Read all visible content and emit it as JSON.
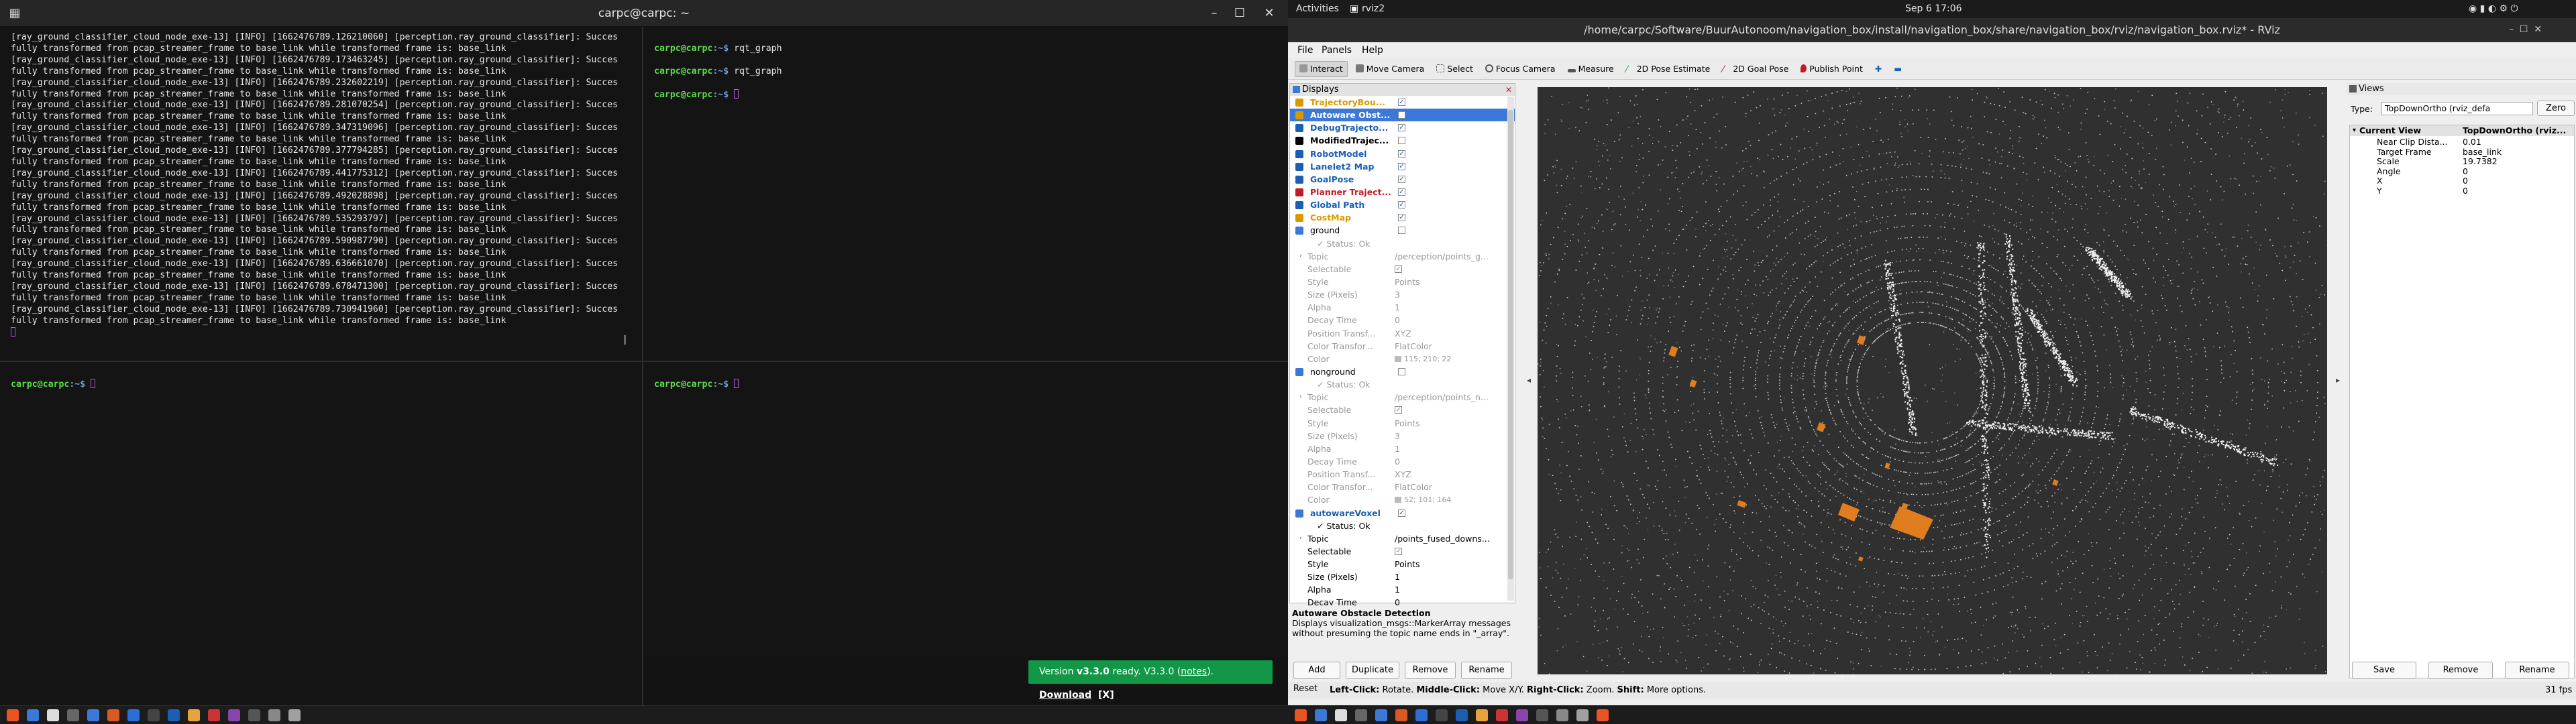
{
  "terminal": {
    "title": "carpc@carpc: ~",
    "log_lines": [
      "[ray_ground_classifier_cloud_node_exe-13] [INFO] [1662476789.126210060] [perception.ray_ground_classifier]: Succes",
      "fully transformed from pcap_streamer_frame to base_link while transformed frame is: base_link",
      "[ray_ground_classifier_cloud_node_exe-13] [INFO] [1662476789.173463245] [perception.ray_ground_classifier]: Succes",
      "fully transformed from pcap_streamer_frame to base_link while transformed frame is: base_link",
      "[ray_ground_classifier_cloud_node_exe-13] [INFO] [1662476789.232602219] [perception.ray_ground_classifier]: Succes",
      "fully transformed from pcap_streamer_frame to base_link while transformed frame is: base_link",
      "[ray_ground_classifier_cloud_node_exe-13] [INFO] [1662476789.281070254] [perception.ray_ground_classifier]: Succes",
      "fully transformed from pcap_streamer_frame to base_link while transformed frame is: base_link",
      "[ray_ground_classifier_cloud_node_exe-13] [INFO] [1662476789.347319096] [perception.ray_ground_classifier]: Succes",
      "fully transformed from pcap_streamer_frame to base_link while transformed frame is: base_link",
      "[ray_ground_classifier_cloud_node_exe-13] [INFO] [1662476789.377794285] [perception.ray_ground_classifier]: Succes",
      "fully transformed from pcap_streamer_frame to base_link while transformed frame is: base_link",
      "[ray_ground_classifier_cloud_node_exe-13] [INFO] [1662476789.441775312] [perception.ray_ground_classifier]: Succes",
      "fully transformed from pcap_streamer_frame to base_link while transformed frame is: base_link",
      "[ray_ground_classifier_cloud_node_exe-13] [INFO] [1662476789.492028898] [perception.ray_ground_classifier]: Succes",
      "fully transformed from pcap_streamer_frame to base_link while transformed frame is: base_link",
      "[ray_ground_classifier_cloud_node_exe-13] [INFO] [1662476789.535293797] [perception.ray_ground_classifier]: Succes",
      "fully transformed from pcap_streamer_frame to base_link while transformed frame is: base_link",
      "[ray_ground_classifier_cloud_node_exe-13] [INFO] [1662476789.590987790] [perception.ray_ground_classifier]: Succes",
      "fully transformed from pcap_streamer_frame to base_link while transformed frame is: base_link",
      "[ray_ground_classifier_cloud_node_exe-13] [INFO] [1662476789.636661070] [perception.ray_ground_classifier]: Succes",
      "fully transformed from pcap_streamer_frame to base_link while transformed frame is: base_link",
      "[ray_ground_classifier_cloud_node_exe-13] [INFO] [1662476789.678471300] [perception.ray_ground_classifier]: Succes",
      "fully transformed from pcap_streamer_frame to base_link while transformed frame is: base_link",
      "[ray_ground_classifier_cloud_node_exe-13] [INFO] [1662476789.730941960] [perception.ray_ground_classifier]: Succes",
      "fully transformed from pcap_streamer_frame to base_link while transformed frame is: base_link"
    ],
    "prompt_user": "carpc@carpc",
    "prompt_path": ":~$ ",
    "commands": [
      "rqt_graph",
      "rqt_graph"
    ],
    "notification": {
      "prefix": "Version ",
      "version": "v3.3.0",
      "middle": " ready. V3.3.0 (",
      "notes": "notes",
      "after": "). ",
      "download": "Download",
      "close": "[X]"
    }
  },
  "gnome": {
    "activities": "Activities",
    "app": "rviz2",
    "clock": "Sep 6  17:06"
  },
  "rviz": {
    "title": "/home/carpc/Software/BuurAutonoom/navigation_box/install/navigation_box/share/navigation_box/rviz/navigation_box.rviz* - RViz",
    "menu": [
      "File",
      "Panels",
      "Help"
    ],
    "tools": [
      "Interact",
      "Move Camera",
      "Select",
      "Focus Camera",
      "Measure",
      "2D Pose Estimate",
      "2D Goal Pose",
      "Publish Point"
    ],
    "displays_title": "Displays",
    "displays": [
      {
        "name": "TrajectoryBou...",
        "color": "#d99a00",
        "checked": true
      },
      {
        "name": "Autoware Obst...",
        "color": "#d99a00",
        "checked": false,
        "selected": true
      },
      {
        "name": "DebugTrajecto...",
        "color": "#1a5fb4",
        "checked": true
      },
      {
        "name": "ModifiedTrajec...",
        "color": "#000000",
        "checked": false
      },
      {
        "name": "RobotModel",
        "color": "#1a5fb4",
        "checked": true
      },
      {
        "name": "Lanelet2 Map",
        "color": "#1a5fb4",
        "checked": true
      },
      {
        "name": "GoalPose",
        "color": "#1a5fb4",
        "checked": true
      },
      {
        "name": "Planner Traject...",
        "color": "#c01c28",
        "checked": true
      },
      {
        "name": "Global Path",
        "color": "#1a5fb4",
        "checked": true
      },
      {
        "name": "CostMap",
        "color": "#d99a00",
        "checked": true
      }
    ],
    "ground": {
      "name": "ground",
      "status": "Status: Ok",
      "props": [
        [
          "Topic",
          "/perception/points_g..."
        ],
        [
          "Selectable",
          ""
        ],
        [
          "Style",
          "Points"
        ],
        [
          "Size (Pixels)",
          "3"
        ],
        [
          "Alpha",
          "1"
        ],
        [
          "Decay Time",
          "0"
        ],
        [
          "Position Transf...",
          "XYZ"
        ],
        [
          "Color Transfor...",
          "FlatColor"
        ],
        [
          "Color",
          "115; 210; 22"
        ]
      ]
    },
    "nonground": {
      "name": "nonground",
      "status": "Status: Ok",
      "props": [
        [
          "Topic",
          "/perception/points_n..."
        ],
        [
          "Selectable",
          ""
        ],
        [
          "Style",
          "Points"
        ],
        [
          "Size (Pixels)",
          "3"
        ],
        [
          "Alpha",
          "1"
        ],
        [
          "Decay Time",
          "0"
        ],
        [
          "Position Transf...",
          "XYZ"
        ],
        [
          "Color Transfor...",
          "FlatColor"
        ],
        [
          "Color",
          "52; 101; 164"
        ]
      ]
    },
    "voxel": {
      "name": "autowareVoxel",
      "status": "Status: Ok",
      "props": [
        [
          "Topic",
          "/points_fused_downs..."
        ],
        [
          "Selectable",
          ""
        ],
        [
          "Style",
          "Points"
        ],
        [
          "Size (Pixels)",
          "1"
        ],
        [
          "Alpha",
          "1"
        ],
        [
          "Decay Time",
          "0"
        ]
      ]
    },
    "desc_title": "Autoware Obstacle Detection",
    "desc_text": "Displays visualization_msgs::MarkerArray messages without presuming the topic name ends in \"_array\".",
    "display_buttons": [
      "Add",
      "Duplicate",
      "Remove",
      "Rename"
    ],
    "views": {
      "title": "Views",
      "type_label": "Type:",
      "type_value": "TopDownOrtho (rviz_defa",
      "zero": "Zero",
      "col1": "Current View",
      "col2": "TopDownOrtho (rviz...",
      "rows": [
        [
          "Near Clip Dista...",
          "0.01"
        ],
        [
          "Target Frame",
          "base_link"
        ],
        [
          "Scale",
          "19.7382"
        ],
        [
          "Angle",
          "0"
        ],
        [
          "X",
          "0"
        ],
        [
          "Y",
          "0"
        ]
      ],
      "buttons": [
        "Save",
        "Remove",
        "Rename"
      ]
    },
    "status": {
      "reset": "Reset",
      "left": "Left-Click:",
      "left_t": " Rotate. ",
      "middle": "Middle-Click:",
      "middle_t": " Move X/Y. ",
      "right": "Right-Click:",
      "right_t": " Zoom. ",
      "shift": "Shift:",
      "shift_t": " More options.",
      "fps": "31 fps"
    }
  },
  "colors": {
    "accent": "#3b78d8",
    "obstacle": "#e07d1f",
    "notify": "#129747"
  }
}
